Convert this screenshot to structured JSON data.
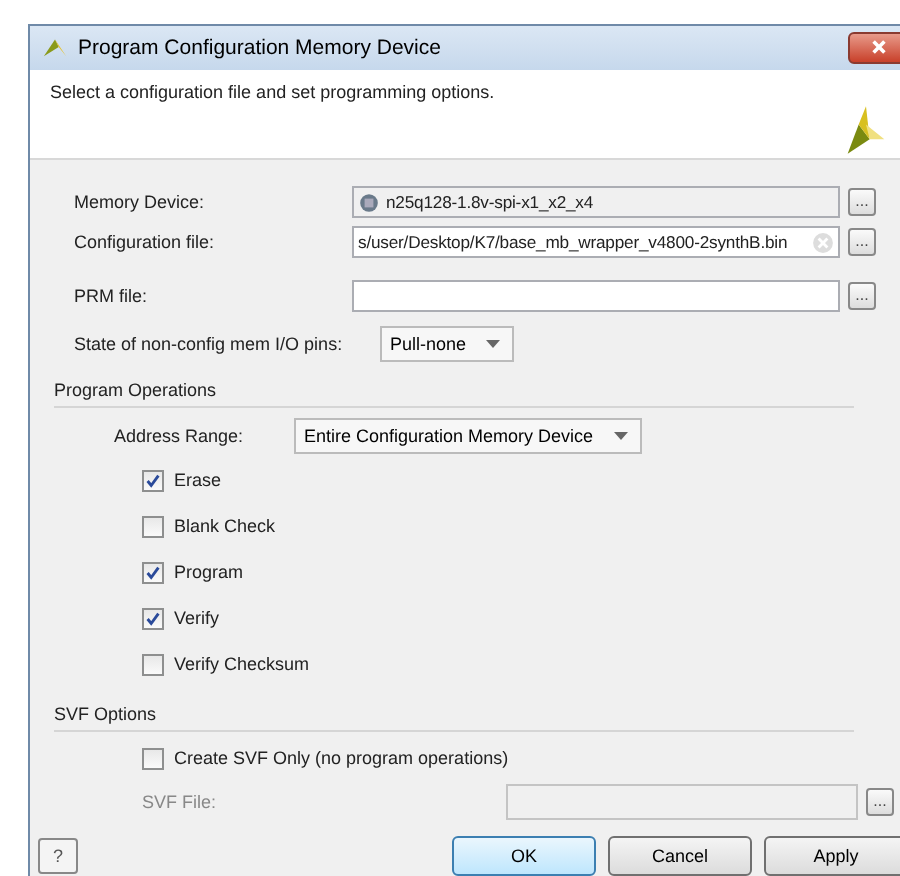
{
  "window": {
    "title": "Program Configuration Memory Device"
  },
  "header": {
    "text": "Select a configuration file and set programming options."
  },
  "fields": [
    {
      "label": "Memory Device:",
      "value": "n25q128-1.8v-spi-x1_x2_x4",
      "kind": "device"
    },
    {
      "label": "Configuration file:",
      "value": "s/user/Desktop/K7/base_mb_wrapper_v4800-2synthB.bin",
      "kind": "file"
    },
    {
      "label": "PRM file:",
      "kind": "plain"
    }
  ],
  "browse_label": "...",
  "pins": {
    "label": "State of non-config mem I/O pins:",
    "value": "Pull-none"
  },
  "program_operations": {
    "title": "Program Operations",
    "address_label": "Address Range:",
    "address_value": "Entire Configuration Memory Device",
    "checks": [
      {
        "label": "Erase",
        "checked": true
      },
      {
        "label": "Blank Check",
        "checked": false
      },
      {
        "label": "Program",
        "checked": true
      },
      {
        "label": "Verify",
        "checked": true
      },
      {
        "label": "Verify Checksum",
        "checked": false
      }
    ]
  },
  "svf_options": {
    "title": "SVF Options",
    "create": {
      "label": "Create SVF Only (no program operations)",
      "checked": false
    },
    "file_label": "SVF File:",
    "file_disabled": true
  },
  "help": "?",
  "buttons": [
    "OK",
    "Cancel",
    "Apply"
  ]
}
